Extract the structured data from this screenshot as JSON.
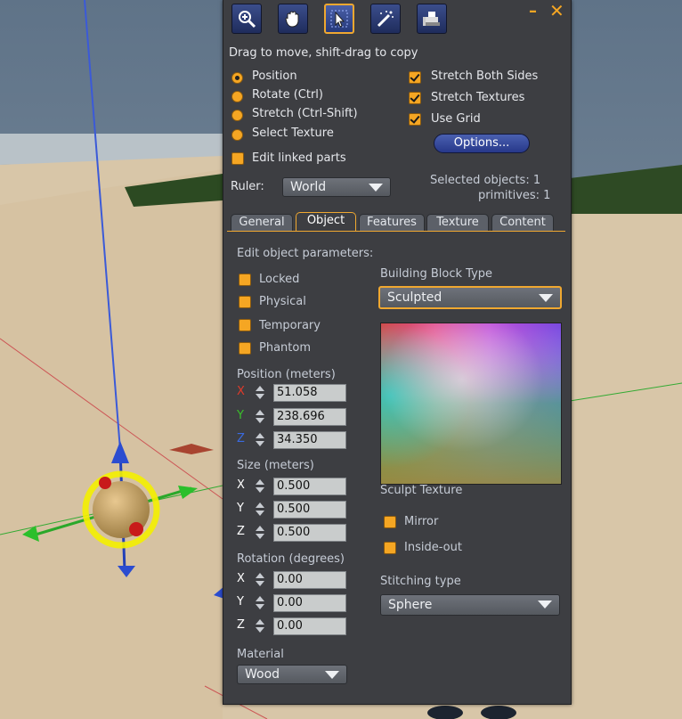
{
  "toolbar": {
    "tools": [
      "zoom-icon",
      "grab-hand-icon",
      "select-arrow-icon",
      "magic-wand-icon",
      "land-bulldozer-icon"
    ],
    "active_tool": 2
  },
  "hint": "Drag to move, shift-drag to copy",
  "modes": {
    "position": "Position",
    "rotate": "Rotate (Ctrl)",
    "stretch": "Stretch (Ctrl-Shift)",
    "select_texture": "Select Texture",
    "selected": "Position"
  },
  "options_checks": {
    "stretch_both_sides": "Stretch Both Sides",
    "stretch_textures": "Stretch Textures",
    "use_grid": "Use Grid"
  },
  "options_button": "Options...",
  "edit_linked": "Edit linked parts",
  "ruler": {
    "label": "Ruler:",
    "value": "World"
  },
  "selection": {
    "objects": "Selected objects: 1",
    "primitives": "primitives: 1"
  },
  "tabs": [
    "General",
    "Object",
    "Features",
    "Texture",
    "Content"
  ],
  "active_tab": "Object",
  "object": {
    "heading": "Edit object parameters:",
    "locked": "Locked",
    "physical": "Physical",
    "temporary": "Temporary",
    "phantom": "Phantom",
    "position_label": "Position (meters)",
    "position": {
      "x": "51.058",
      "y": "238.696",
      "z": "34.350"
    },
    "size_label": "Size (meters)",
    "size": {
      "x": "0.500",
      "y": "0.500",
      "z": "0.500"
    },
    "rotation_label": "Rotation (degrees)",
    "rotation": {
      "x": "0.00",
      "y": "0.00",
      "z": "0.00"
    },
    "axis": {
      "x": "X",
      "y": "Y",
      "z": "Z"
    },
    "material_label": "Material",
    "material": "Wood",
    "block_type_label": "Building Block Type",
    "block_type": "Sculpted",
    "sculpt_texture_label": "Sculpt Texture",
    "mirror": "Mirror",
    "inside_out": "Inside-out",
    "stitching_label": "Stitching type",
    "stitching": "Sphere"
  },
  "colors": {
    "accent": "#f5a623",
    "panel_bg": "#3d3e42",
    "axis_x": "#e03a2a",
    "axis_y": "#3ac02a",
    "axis_z": "#3a6ae0"
  }
}
